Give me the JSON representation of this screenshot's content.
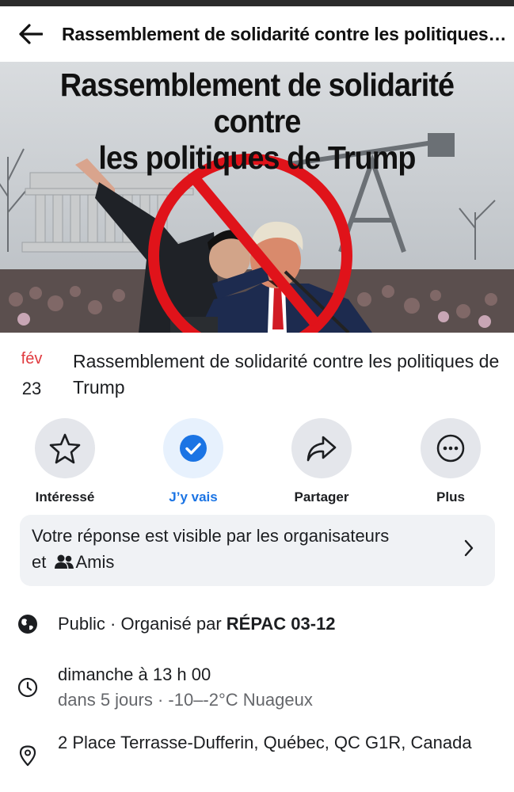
{
  "header": {
    "title": "Rassemblement de solidarité contre les politiques de Trump"
  },
  "cover": {
    "headline_line1": "Rassemblement de solidarité contre",
    "headline_line2": "les politiques de Trump"
  },
  "event": {
    "month": "fév",
    "day": "23",
    "title": "Rassemblement de solidarité contre les politiques de Trump"
  },
  "actions": [
    {
      "label": "Intéressé",
      "icon": "star-icon"
    },
    {
      "label": "J’y vais",
      "icon": "check-circle-icon"
    },
    {
      "label": "Partager",
      "icon": "share-icon"
    },
    {
      "label": "Plus",
      "icon": "more-icon"
    }
  ],
  "visibility": {
    "text_line1": "Votre réponse est visible par les organisateurs",
    "text_prefix": "et",
    "text_friends": "Amis"
  },
  "details": {
    "privacy": "Public · Organisé par",
    "organizer": "RÉPAC 03-12",
    "datetime": "dimanche à 13 h 00",
    "forecast": "dans 5 jours · -10–-2°C Nuageux",
    "address": "2 Place Terrasse-Dufferin, Québec, QC G1R, Canada"
  },
  "colors": {
    "accent": "#1b74e4",
    "date_red": "#e0393e",
    "prohibition_red": "#e0131a"
  }
}
